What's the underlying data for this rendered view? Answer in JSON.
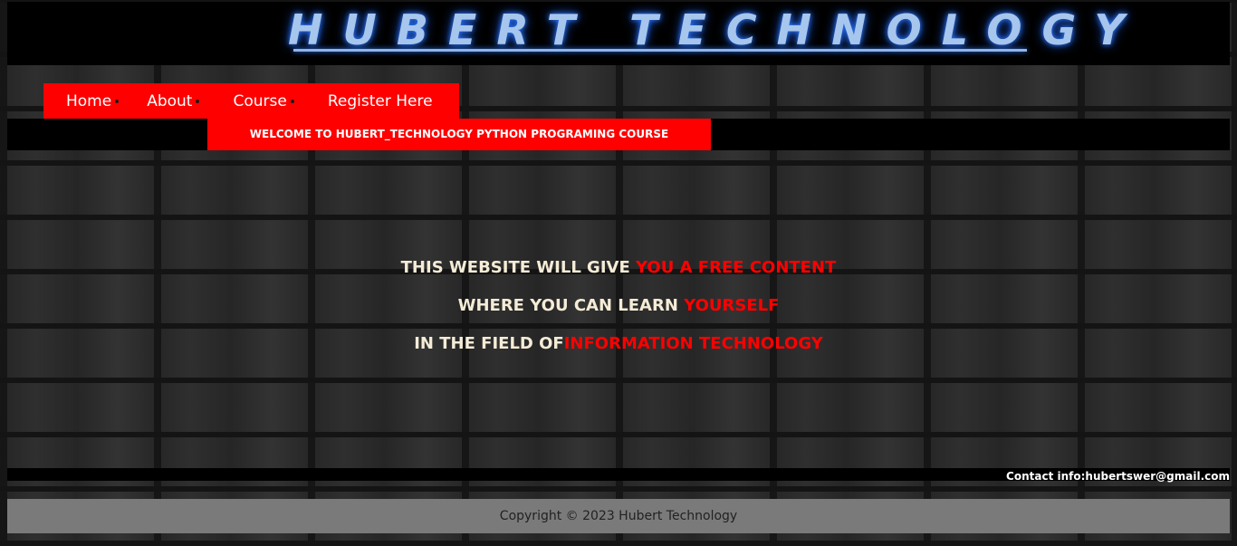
{
  "header": {
    "title": "HUBERT TECHNOLOGY"
  },
  "nav": {
    "items": [
      {
        "label": "Home"
      },
      {
        "label": "About"
      },
      {
        "label": "Course"
      },
      {
        "label": "Register Here"
      }
    ]
  },
  "welcome": {
    "text": "WELCOME TO HUBERT_TECHNOLOGY PYTHON PROGRAMING COURSE"
  },
  "content": {
    "line1_white": "THIS WEBSITE WILL GIVE ",
    "line1_red": "YOU A FREE CONTENT",
    "line2_white": "WHERE YOU CAN LEARN ",
    "line2_red": "YOURSELF",
    "line3_white": "IN THE FIELD OF",
    "line3_red": "INFORMATION TECHNOLOGY"
  },
  "contact": {
    "text": "Contact info:hubertswer@gmail.com"
  },
  "footer": {
    "copyright": "Copyright © 2023 Hubert Technology"
  },
  "colors": {
    "accent": "#ff0000",
    "title_glow": "#2f7bff",
    "title_text": "#a7c6ee",
    "bar": "#000000",
    "footer_bg": "#7a7a7a"
  }
}
